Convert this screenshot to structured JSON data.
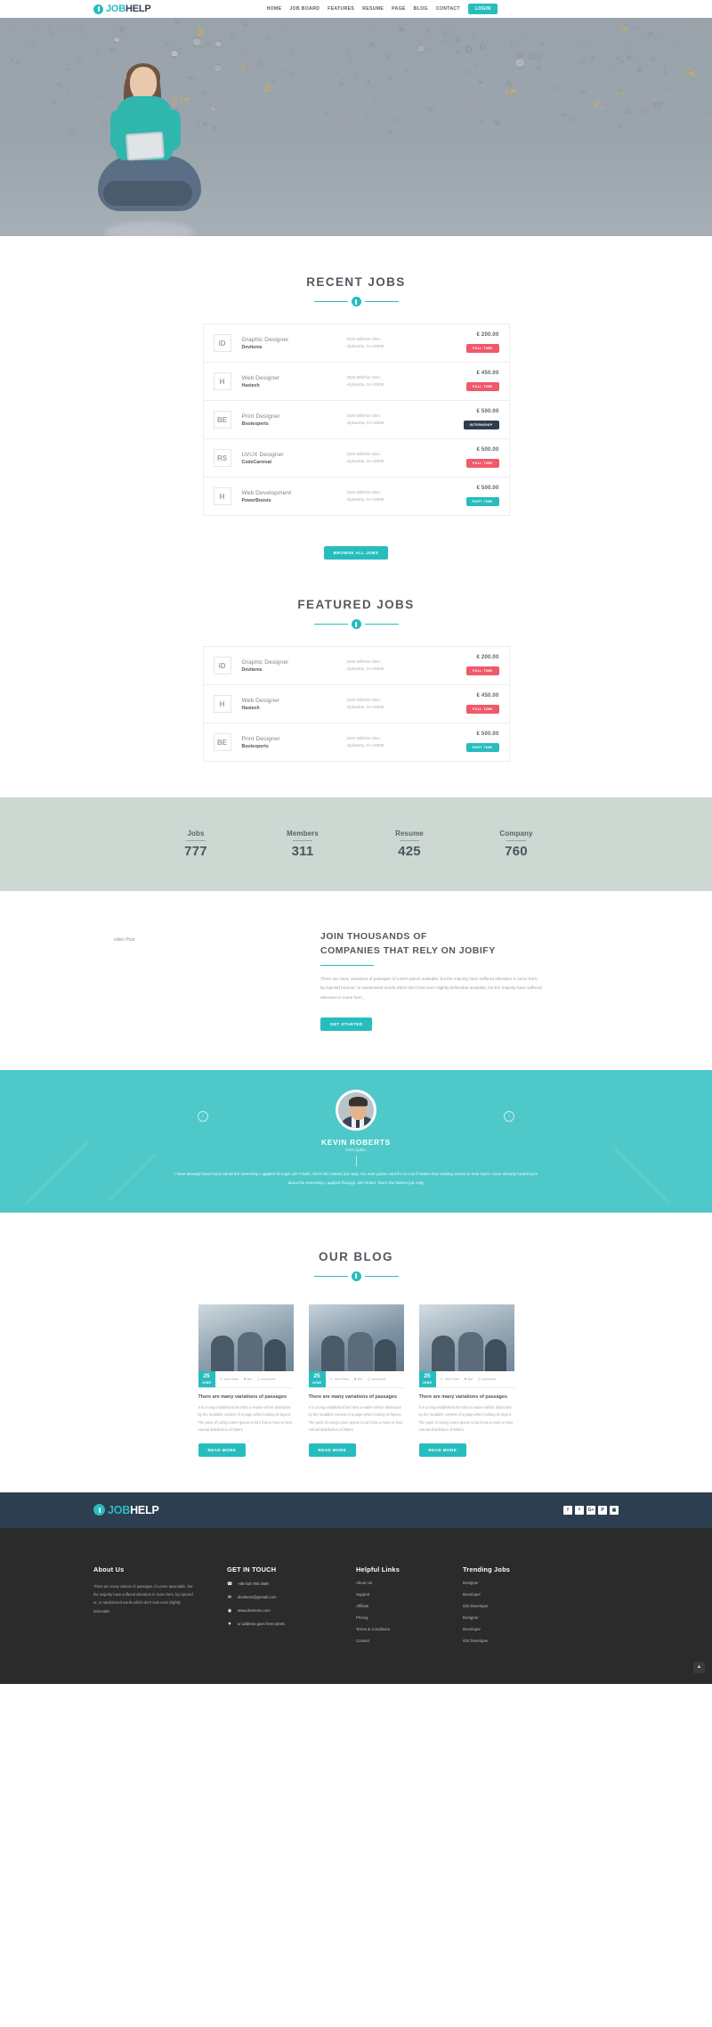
{
  "brand": {
    "part1": "JOB",
    "part2": "HELP"
  },
  "nav": {
    "items": [
      "HOME",
      "JOB BOARD",
      "FEATURES",
      "RESUME",
      "PAGE",
      "BLOG",
      "CONTACT"
    ],
    "login": "LOGIN"
  },
  "recent": {
    "title": "RECENT JOBS",
    "button": "BROWSE ALL JOBS",
    "jobs": [
      {
        "logo": "iD",
        "title": "Graphic Designer",
        "company": "Devitems",
        "addr1": "2020 Willshire Glen,",
        "addr2": "Alpharetta, GA-30009",
        "price": "€ 200.00",
        "badge": "FULL TIME",
        "badge_type": "full"
      },
      {
        "logo": "H",
        "title": "Web Designer",
        "company": "Hastech",
        "addr1": "2020 Willshire Glen,",
        "addr2": "Alpharetta, GA-30009",
        "price": "€ 450.00",
        "badge": "FULL TIME",
        "badge_type": "full"
      },
      {
        "logo": "BE",
        "title": "Print Designer",
        "company": "Bootexperts",
        "addr1": "2020 Willshire Glen,",
        "addr2": "Alpharetta, GA-30009",
        "price": "€ 500.00",
        "badge": "INTERNSHIP",
        "badge_type": "intern"
      },
      {
        "logo": "RS",
        "title": "UI/UX Designer",
        "company": "CodeCarnival",
        "addr1": "2020 Willshire Glen,",
        "addr2": "Alpharetta, GA-30009",
        "price": "€ 500.00",
        "badge": "FULL TIME",
        "badge_type": "full"
      },
      {
        "logo": "H",
        "title": "Web Development",
        "company": "PowerBoosts",
        "addr1": "2020 Willshire Glen,",
        "addr2": "Alpharetta, GA-30009",
        "price": "€ 500.00",
        "badge": "PART TIME",
        "badge_type": "part"
      }
    ]
  },
  "featured": {
    "title": "FEATURED JOBS",
    "jobs": [
      {
        "logo": "iD",
        "title": "Graphic Designer",
        "company": "Devitems",
        "addr1": "2020 Willshire Glen,",
        "addr2": "Alpharetta, GA-30009",
        "price": "€ 200.00",
        "badge": "FULL TIME",
        "badge_type": "full"
      },
      {
        "logo": "H",
        "title": "Web Designer",
        "company": "Hastech",
        "addr1": "2020 Willshire Glen,",
        "addr2": "Alpharetta, GA-30009",
        "price": "€ 450.00",
        "badge": "FULL TIME",
        "badge_type": "full"
      },
      {
        "logo": "BE",
        "title": "Print Designer",
        "company": "Bootexperts",
        "addr1": "2020 Willshire Glen,",
        "addr2": "Alpharetta, GA-30009",
        "price": "€ 500.00",
        "badge": "PART TIME",
        "badge_type": "part"
      }
    ]
  },
  "counters": [
    {
      "label": "Jobs",
      "value": "777"
    },
    {
      "label": "Members",
      "value": "311"
    },
    {
      "label": "Resume",
      "value": "425"
    },
    {
      "label": "Company",
      "value": "760"
    }
  ],
  "join": {
    "video_label": "video Post",
    "heading_l1": "JOIN THOUSANDS OF",
    "heading_l2": "COMPANIES THAT RELY ON JOBIFY",
    "paragraph": "There are many variations of passages of Lorem Ipsum available, but the majority have suffered alteration in some form, by injected humour, or randomised words which don't look even slightly believable.available, but the majority have suffered alteration in some form,",
    "button": "GET STARTED"
  },
  "testimonial": {
    "name": "KEVIN ROBERTS",
    "role": "CEO,Ajobko",
    "quote": "I have already heard back about the internship I applied through Job Finder, that's the fastest job reply I've ever gotten and it's so much better than waiting weeks to hear back.I have already heard back about the internship I applied through Job Finder, that's the fastest job reply",
    "prev": "‹",
    "next": "›"
  },
  "blog": {
    "title": "OUR BLOG",
    "posts": [
      {
        "day": "25",
        "month": "JUNE",
        "author": "amir khan",
        "like": "like",
        "comments": "comments",
        "title": "There are many variations of passages",
        "text": "It is a long established fact that a reader will be distracted by the readable content of a page when looking its layout. The point of using Lorem Ipsum is tat it has a more-or-less normal distribution of letters",
        "button": "READ MORE"
      },
      {
        "day": "25",
        "month": "JUNE",
        "author": "amir khan",
        "like": "like",
        "comments": "comments",
        "title": "There are many variations of passages",
        "text": "It is a long established fact that a reader will be distracted by the readable content of a page when looking its layout. The point of using Lorem Ipsum is tat it has a more-or-less normal distribution of letters",
        "button": "READ MORE"
      },
      {
        "day": "25",
        "month": "JUNE",
        "author": "amir khan",
        "like": "like",
        "comments": "comments",
        "title": "There are many variations of passages",
        "text": "It is a long established fact that a reader will be distracted by the readable content of a page when looking its layout. The point of using Lorem Ipsum is tat it has a more-or-less normal distribution of letters",
        "button": "READ MORE"
      }
    ]
  },
  "footer": {
    "social": [
      "f",
      "ᴿ",
      "G+",
      "P",
      "▣"
    ],
    "about": {
      "heading": "About Us",
      "text": "There are many vations of passages of Lorem Ipsumable, but the majority have suffered alteration in some form, by injected ur, or randomised words which don't look even slightly believable"
    },
    "contact": {
      "heading": "GET IN TOUCH",
      "items": [
        {
          "icon": "☎",
          "text": "+88 018 785 4589"
        },
        {
          "icon": "✉",
          "text": "devitems@gemail.com"
        },
        {
          "icon": "◉",
          "text": "www.devitems.com"
        },
        {
          "icon": "▼",
          "text": "ur address goes here,street."
        }
      ]
    },
    "helpful": {
      "heading": "Helpful Links",
      "links": [
        "About Us",
        "Support",
        "Affiliate",
        "Pricing",
        "Terms & Conditions",
        "Contact"
      ]
    },
    "trending": {
      "heading": "Trending Jobs",
      "links": [
        "Designer",
        "Developer",
        "iOS Developer",
        "Designer",
        "Developer",
        "iOS Developer"
      ]
    },
    "scroll_top": "▲"
  },
  "colors": {
    "accent": "#27bdbe",
    "danger": "#f0596a",
    "dark": "#2d3e50"
  }
}
